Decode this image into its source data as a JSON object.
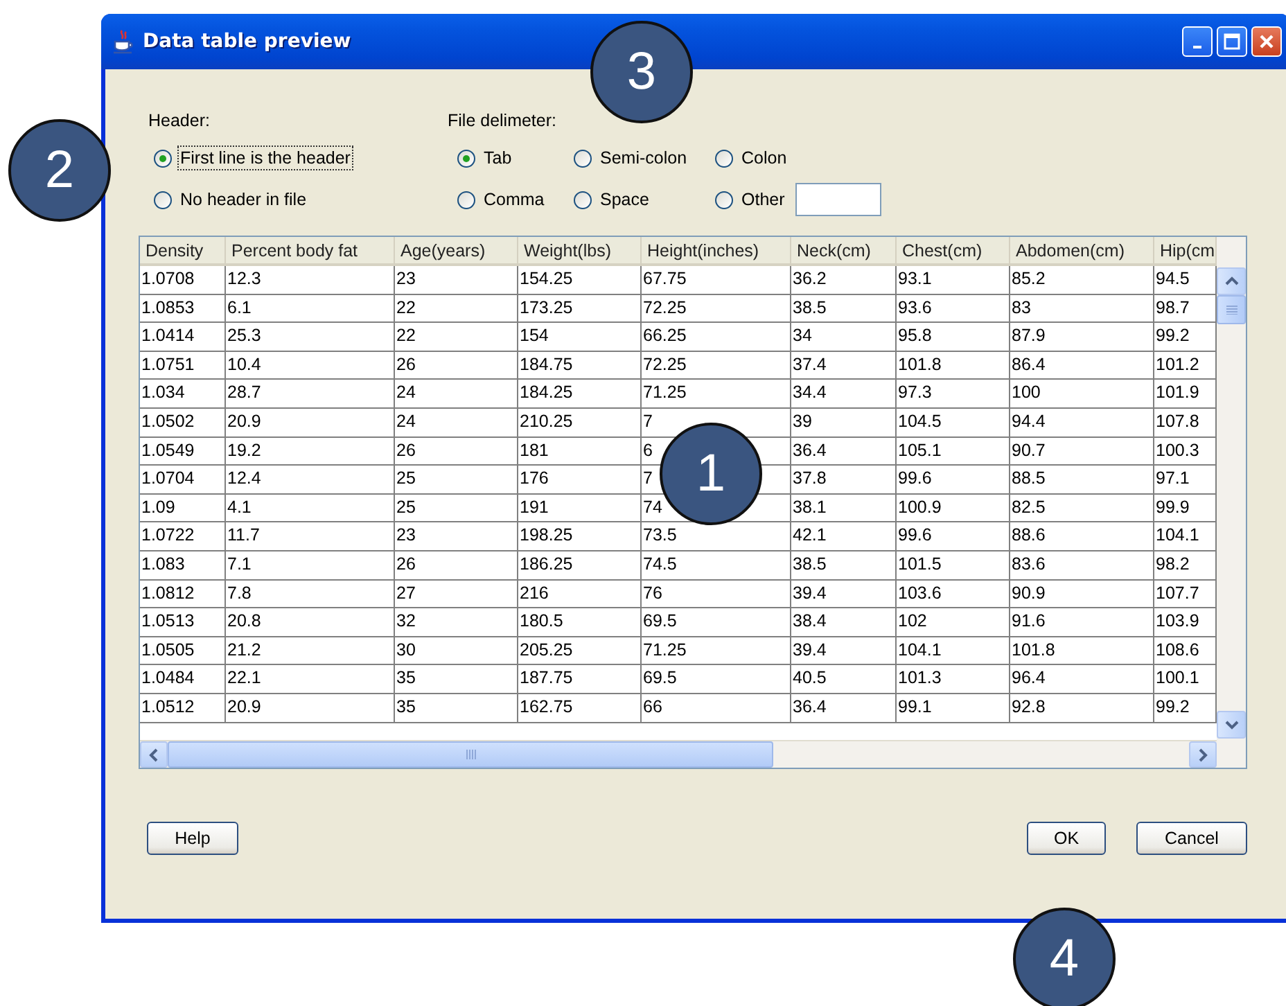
{
  "window": {
    "title": "Data table preview"
  },
  "header_options": {
    "label": "Header:",
    "options": [
      {
        "label": "First line is the header",
        "selected": true,
        "focused": true
      },
      {
        "label": "No header in file",
        "selected": false,
        "focused": false
      }
    ]
  },
  "delimiter": {
    "label": "File delimeter:",
    "options": [
      {
        "kind": "radio",
        "label": "Tab",
        "selected": true
      },
      {
        "kind": "radio",
        "label": "Semi-colon",
        "selected": false
      },
      {
        "kind": "radio",
        "label": "Colon",
        "selected": false
      },
      {
        "kind": "radio",
        "label": "Comma",
        "selected": false
      },
      {
        "kind": "radio",
        "label": "Space",
        "selected": false
      },
      {
        "kind": "radio_field",
        "label": "Other",
        "selected": false
      }
    ]
  },
  "table": {
    "columns": [
      "Density",
      "Percent body fat",
      "Age(years)",
      "Weight(lbs)",
      "Height(inches)",
      "Neck(cm)",
      "Chest(cm)",
      "Abdomen(cm)",
      "Hip(cm"
    ],
    "rows": [
      [
        "1.0708",
        "12.3",
        "23",
        "154.25",
        "67.75",
        "36.2",
        "93.1",
        "85.2",
        "94.5"
      ],
      [
        "1.0853",
        "6.1",
        "22",
        "173.25",
        "72.25",
        "38.5",
        "93.6",
        "83",
        "98.7"
      ],
      [
        "1.0414",
        "25.3",
        "22",
        "154",
        "66.25",
        "34",
        "95.8",
        "87.9",
        "99.2"
      ],
      [
        "1.0751",
        "10.4",
        "26",
        "184.75",
        "72.25",
        "37.4",
        "101.8",
        "86.4",
        "101.2"
      ],
      [
        "1.034",
        "28.7",
        "24",
        "184.25",
        "71.25",
        "34.4",
        "97.3",
        "100",
        "101.9"
      ],
      [
        "1.0502",
        "20.9",
        "24",
        "210.25",
        "7",
        "39",
        "104.5",
        "94.4",
        "107.8"
      ],
      [
        "1.0549",
        "19.2",
        "26",
        "181",
        "6",
        "36.4",
        "105.1",
        "90.7",
        "100.3"
      ],
      [
        "1.0704",
        "12.4",
        "25",
        "176",
        "7",
        "37.8",
        "99.6",
        "88.5",
        "97.1"
      ],
      [
        "1.09",
        "4.1",
        "25",
        "191",
        "74",
        "38.1",
        "100.9",
        "82.5",
        "99.9"
      ],
      [
        "1.0722",
        "11.7",
        "23",
        "198.25",
        "73.5",
        "42.1",
        "99.6",
        "88.6",
        "104.1"
      ],
      [
        "1.083",
        "7.1",
        "26",
        "186.25",
        "74.5",
        "38.5",
        "101.5",
        "83.6",
        "98.2"
      ],
      [
        "1.0812",
        "7.8",
        "27",
        "216",
        "76",
        "39.4",
        "103.6",
        "90.9",
        "107.7"
      ],
      [
        "1.0513",
        "20.8",
        "32",
        "180.5",
        "69.5",
        "38.4",
        "102",
        "91.6",
        "103.9"
      ],
      [
        "1.0505",
        "21.2",
        "30",
        "205.25",
        "71.25",
        "39.4",
        "104.1",
        "101.8",
        "108.6"
      ],
      [
        "1.0484",
        "22.1",
        "35",
        "187.75",
        "69.5",
        "40.5",
        "101.3",
        "96.4",
        "100.1"
      ],
      [
        "1.0512",
        "20.9",
        "35",
        "162.75",
        "66",
        "36.4",
        "99.1",
        "92.8",
        "99.2"
      ]
    ]
  },
  "help_button": "Help",
  "buttons": [
    "OK",
    "Cancel"
  ],
  "callouts": [
    "3",
    "2",
    "1",
    "4"
  ]
}
